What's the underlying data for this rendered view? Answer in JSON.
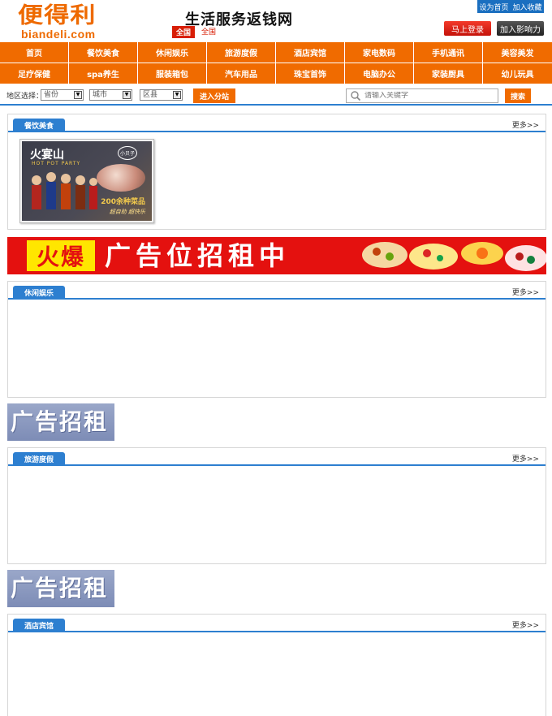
{
  "header": {
    "logo_cn": "便得利",
    "logo_en": "biandeli.com",
    "slogan": "生活服务返钱网",
    "region_badge": "全国",
    "region_link": "全国",
    "set_home": "设为首页",
    "add_fav": "加入收藏",
    "login": "马上登录",
    "join": "加入影响力",
    "brand_color": "#f06b00",
    "accent_blue": "#2d7fd0"
  },
  "nav": [
    "首页",
    "餐饮美食",
    "休闲娱乐",
    "旅游度假",
    "酒店宾馆",
    "家电数码",
    "手机通讯",
    "美容美发",
    "足疗保健",
    "spa养生",
    "服装箱包",
    "汽车用品",
    "珠宝首饰",
    "电脑办公",
    "家装厨具",
    "幼儿玩具"
  ],
  "region_bar": {
    "label": "地区选择：",
    "province": "省份",
    "city": "城市",
    "county": "区县",
    "enter": "进入分站",
    "search_placeholder": "请输入关键字",
    "search_button": "搜索"
  },
  "sections": [
    {
      "title": "餐饮美食",
      "more": "更多>>"
    },
    {
      "title": "休闲娱乐",
      "more": "更多>>"
    },
    {
      "title": "旅游度假",
      "more": "更多>>"
    },
    {
      "title": "酒店宾馆",
      "more": "更多>>"
    }
  ],
  "thumb": {
    "title": "火宴山",
    "subtitle": "HOT POT PARTY",
    "badge": "小贝子",
    "tag": "200余种菜品",
    "tag2": "超自助 超快乐"
  },
  "banners": {
    "hot": "火爆",
    "big_text": "广告位招租中",
    "small_text": "广告招租"
  }
}
